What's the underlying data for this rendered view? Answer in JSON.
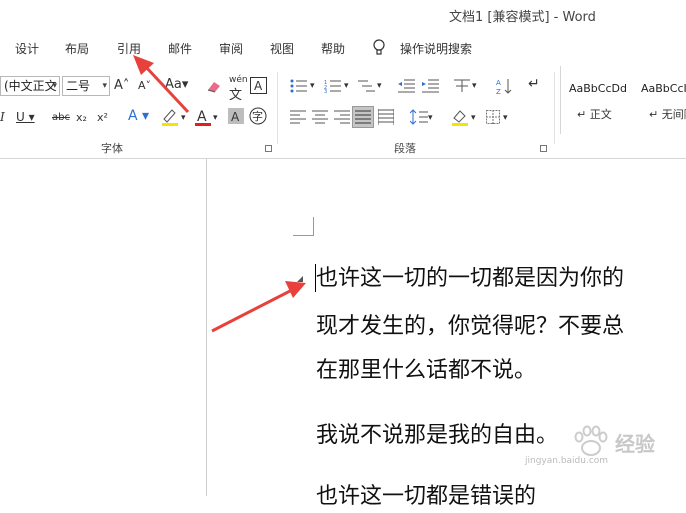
{
  "window": {
    "title": "文档1 [兼容模式] - Word"
  },
  "tabs": [
    "设计",
    "布局",
    "引用",
    "邮件",
    "审阅",
    "视图",
    "帮助"
  ],
  "tell_me": "操作说明搜索",
  "ribbon": {
    "font_name": "(中文正文",
    "font_size": "二号",
    "aa_label": "Aa",
    "pinyin": "wén",
    "groups": {
      "font": "字体",
      "paragraph": "段落"
    }
  },
  "styles": [
    {
      "sample": "AaBbCcDd",
      "name": "正文"
    },
    {
      "sample": "AaBbCcI",
      "name": "无间隔"
    }
  ],
  "document": {
    "paragraphs": [
      "也许这一切的一切都是因为你的",
      "现才发生的，你觉得呢？不要总",
      "在那里什么话都不说。",
      "我说不说那是我的自由。",
      "也许这一切都是错误的"
    ]
  },
  "watermark": {
    "text": "经验",
    "url": "jingyan.baidu.com"
  },
  "colors": {
    "font_color_underline": "#e02020",
    "highlight": "#f2e600",
    "arrow": "#e8413c"
  }
}
